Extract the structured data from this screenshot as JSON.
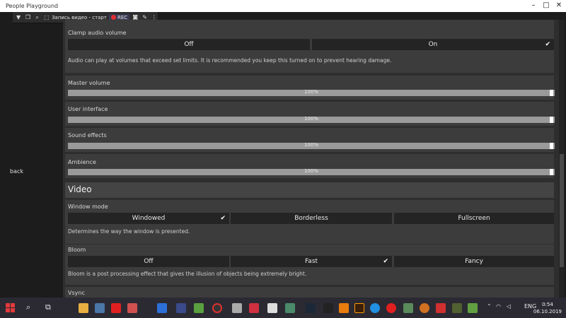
{
  "window": {
    "title": "People Playground"
  },
  "recorder": {
    "text": "Запись видео - старт",
    "rec_label": "REC"
  },
  "nav": {
    "back_label": "back"
  },
  "audio": {
    "clamp": {
      "label": "Clamp audio volume",
      "options": [
        "Off",
        "On"
      ],
      "selected": "On",
      "description": "Audio can play at volumes that exceed set limits. It is recommended you keep this turned on to prevent hearing damage."
    },
    "master": {
      "label": "Master volume",
      "value": "100%"
    },
    "ui": {
      "label": "User interface",
      "value": "100%"
    },
    "sfx": {
      "label": "Sound effects",
      "value": "100%"
    },
    "ambience": {
      "label": "Ambience",
      "value": "100%"
    }
  },
  "video": {
    "section_title": "Video",
    "window_mode": {
      "label": "Window mode",
      "options": [
        "Windowed",
        "Borderless",
        "Fullscreen"
      ],
      "selected": "Windowed",
      "description": "Determines the way the window is presented."
    },
    "bloom": {
      "label": "Bloom",
      "options": [
        "Off",
        "Fast",
        "Fancy"
      ],
      "selected": "Fast",
      "description": "Bloom is a post processing effect that gives the illusion of objects being extremely bright."
    },
    "vsync": {
      "label": "Vsync"
    }
  },
  "taskbar": {
    "language": "ENG",
    "time": "0:54",
    "date": "06.10.2019"
  },
  "colors": {
    "panel": "#2e2e2e",
    "group": "#3c3c3c",
    "option": "#242424",
    "slider": "#9a9a9a",
    "rec_dot": "#e03030"
  }
}
